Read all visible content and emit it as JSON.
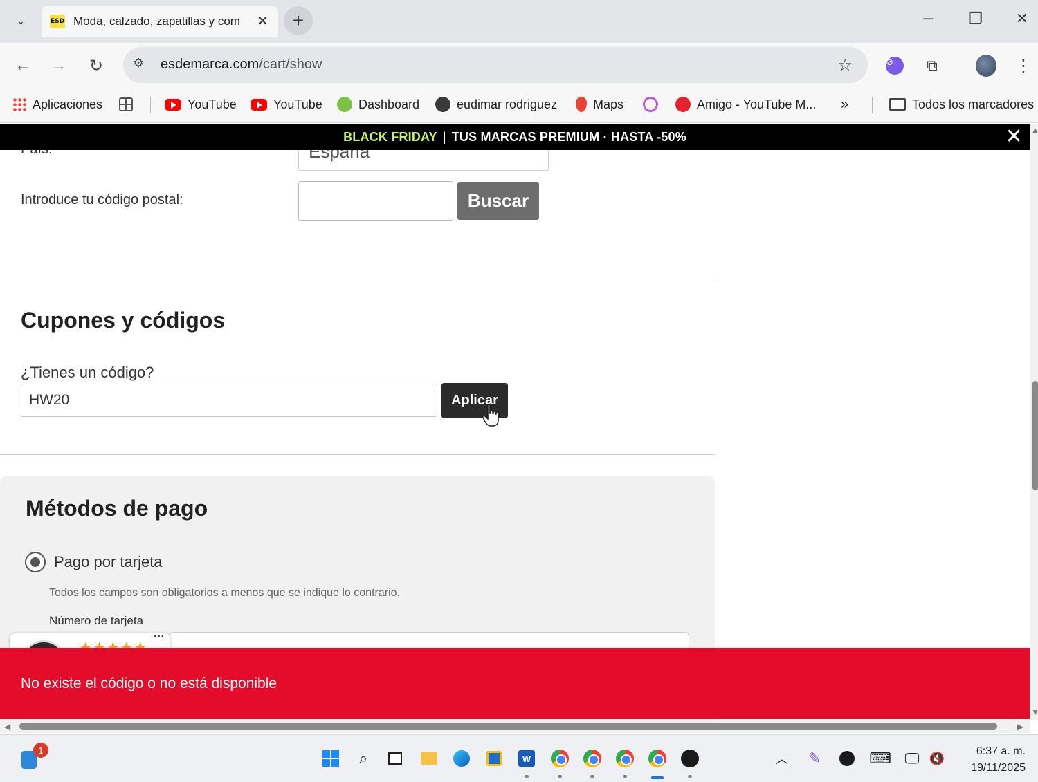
{
  "browser": {
    "tab": {
      "title": "Moda, calzado, zapatillas y com",
      "favicon_text": "ESD"
    },
    "url": {
      "host": "esdemarca.com",
      "path": "/cart/show"
    },
    "bookmarks": [
      {
        "label": "Aplicaciones",
        "icon": "apps-grid-icon"
      },
      {
        "label": "YouTube",
        "icon": "youtube-icon"
      },
      {
        "label": "YouTube",
        "icon": "youtube-icon"
      },
      {
        "label": "Dashboard",
        "icon": "dashboard-icon"
      },
      {
        "label": "eudimar rodriguez",
        "icon": "globe-icon"
      },
      {
        "label": "Maps",
        "icon": "maps-pin-icon"
      },
      {
        "label": "Amigo - YouTube M...",
        "icon": "youtube-music-icon"
      },
      {
        "label": "Todos los marcadores",
        "icon": "folder-icon"
      }
    ]
  },
  "page": {
    "promo": {
      "highlight": "BLACK FRIDAY",
      "text": "TUS MARCAS PREMIUM · HASTA -50%"
    },
    "shipping": {
      "country_label": "País:",
      "country_value": "España",
      "postal_label": "Introduce tu código postal:",
      "postal_value": "",
      "search_button": "Buscar"
    },
    "coupons": {
      "title": "Cupones y códigos",
      "label": "¿Tienes un código?",
      "value": "HW20",
      "apply_button": "Aplicar"
    },
    "payment": {
      "title": "Métodos de pago",
      "option": "Pago por tarjeta",
      "required_note": "Todos los campos son obligatorios a menos que se indique lo contrario.",
      "card_label": "Número de tarjeta",
      "trust_stars": "★★★★★",
      "trust_more": "···"
    },
    "toast": {
      "message": "No existe el código o no está disponible",
      "color": "#e30c2b"
    }
  },
  "taskbar": {
    "notification_count": "1",
    "time": "6:37 a. m.",
    "date": "19/11/2025"
  }
}
